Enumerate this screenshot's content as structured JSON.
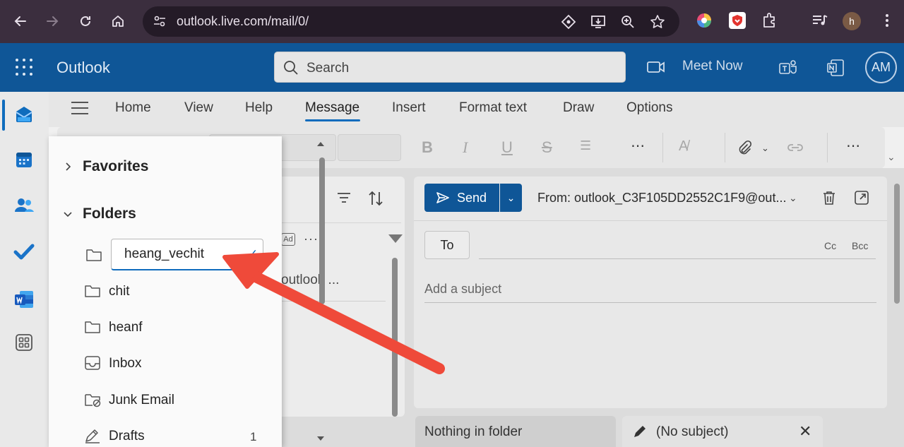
{
  "browser": {
    "url": "outlook.live.com/mail/0/",
    "profile_initial": "h"
  },
  "app": {
    "title": "Outlook",
    "search_placeholder": "Search",
    "meet_now": "Meet Now",
    "avatar_initials": "AM"
  },
  "ribbon": {
    "tabs": [
      "Home",
      "View",
      "Help",
      "Message",
      "Insert",
      "Format text",
      "Draw",
      "Options"
    ],
    "active_tab": "Message"
  },
  "folders_panel": {
    "favorites_label": "Favorites",
    "folders_label": "Folders",
    "rename_value": "heang_vechit",
    "items": [
      {
        "label": "chit",
        "count": ""
      },
      {
        "label": "heanf",
        "count": ""
      },
      {
        "label": "Inbox",
        "count": ""
      },
      {
        "label": "Junk Email",
        "count": ""
      },
      {
        "label": "Drafts",
        "count": "1"
      }
    ]
  },
  "message_list": {
    "ad_badge": "Ad",
    "snippet": "outlook ..."
  },
  "compose": {
    "send_label": "Send",
    "from_label": "From: outlook_C3F105DD2552C1F9@out...",
    "to_label": "To",
    "cc_label": "Cc",
    "bcc_label": "Bcc",
    "subject_placeholder": "Add a subject"
  },
  "bottom_tabs": {
    "empty_folder": "Nothing in folder",
    "draft_tab": "(No subject)"
  },
  "colors": {
    "header_blue": "#0f5697",
    "accent_blue": "#0f6cbd",
    "annotation_red": "#ef4a3a",
    "browser_bg": "#3b2e3e"
  }
}
